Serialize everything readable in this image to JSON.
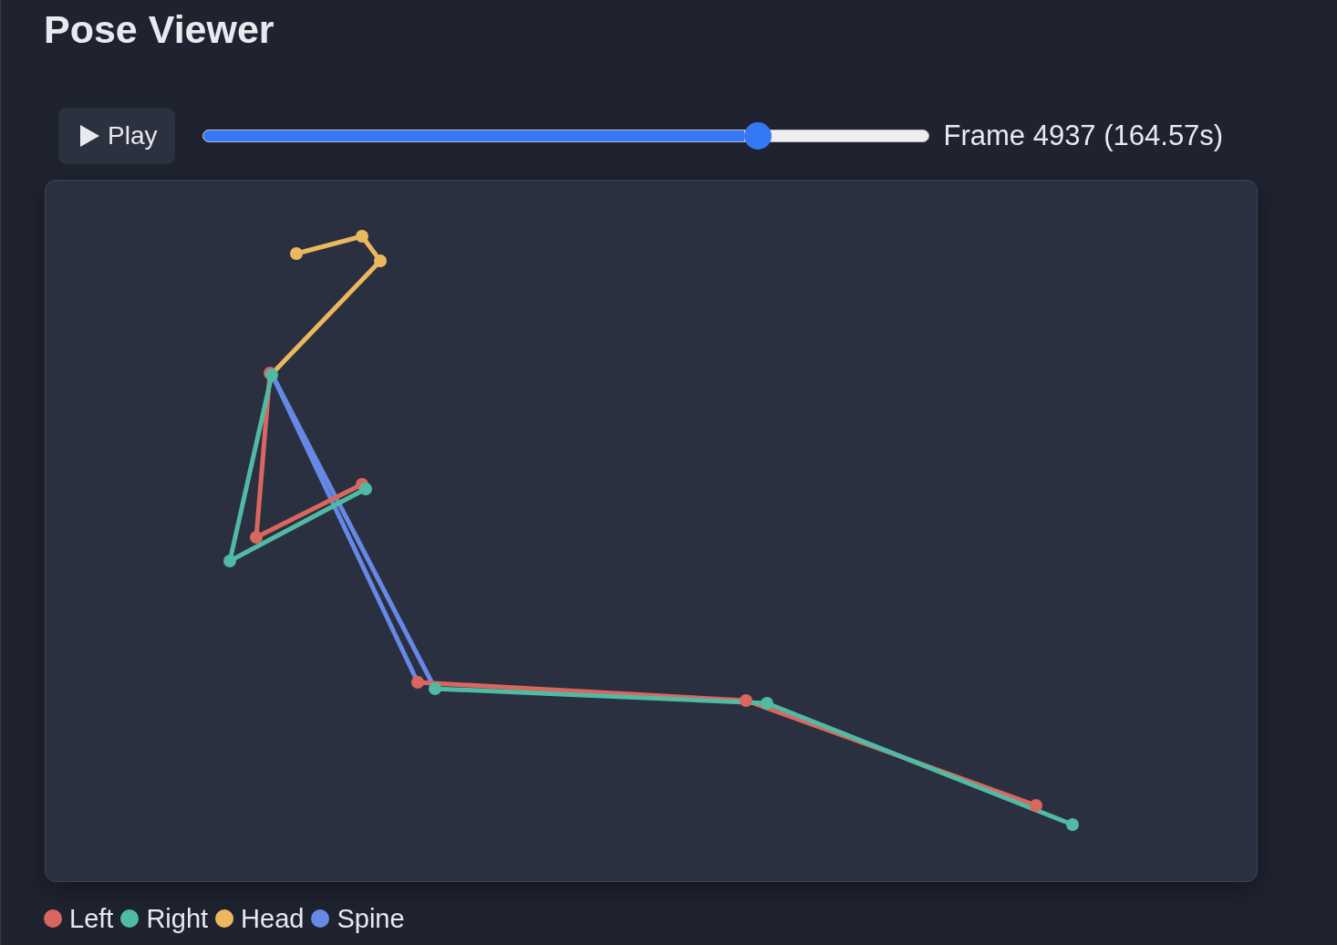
{
  "title": "Pose Viewer",
  "controls": {
    "play_button": {
      "label": "Play"
    },
    "slider": {
      "level": 0.764
    },
    "frame_readout": "Frame 4937 (164.57s)"
  },
  "legend": [
    {
      "label": "Left",
      "color": "#d9675f"
    },
    {
      "label": "Right",
      "color": "#50bba2"
    },
    {
      "label": "Head",
      "color": "#ebb85e"
    },
    {
      "label": "Spine",
      "color": "#6589e5"
    }
  ]
}
